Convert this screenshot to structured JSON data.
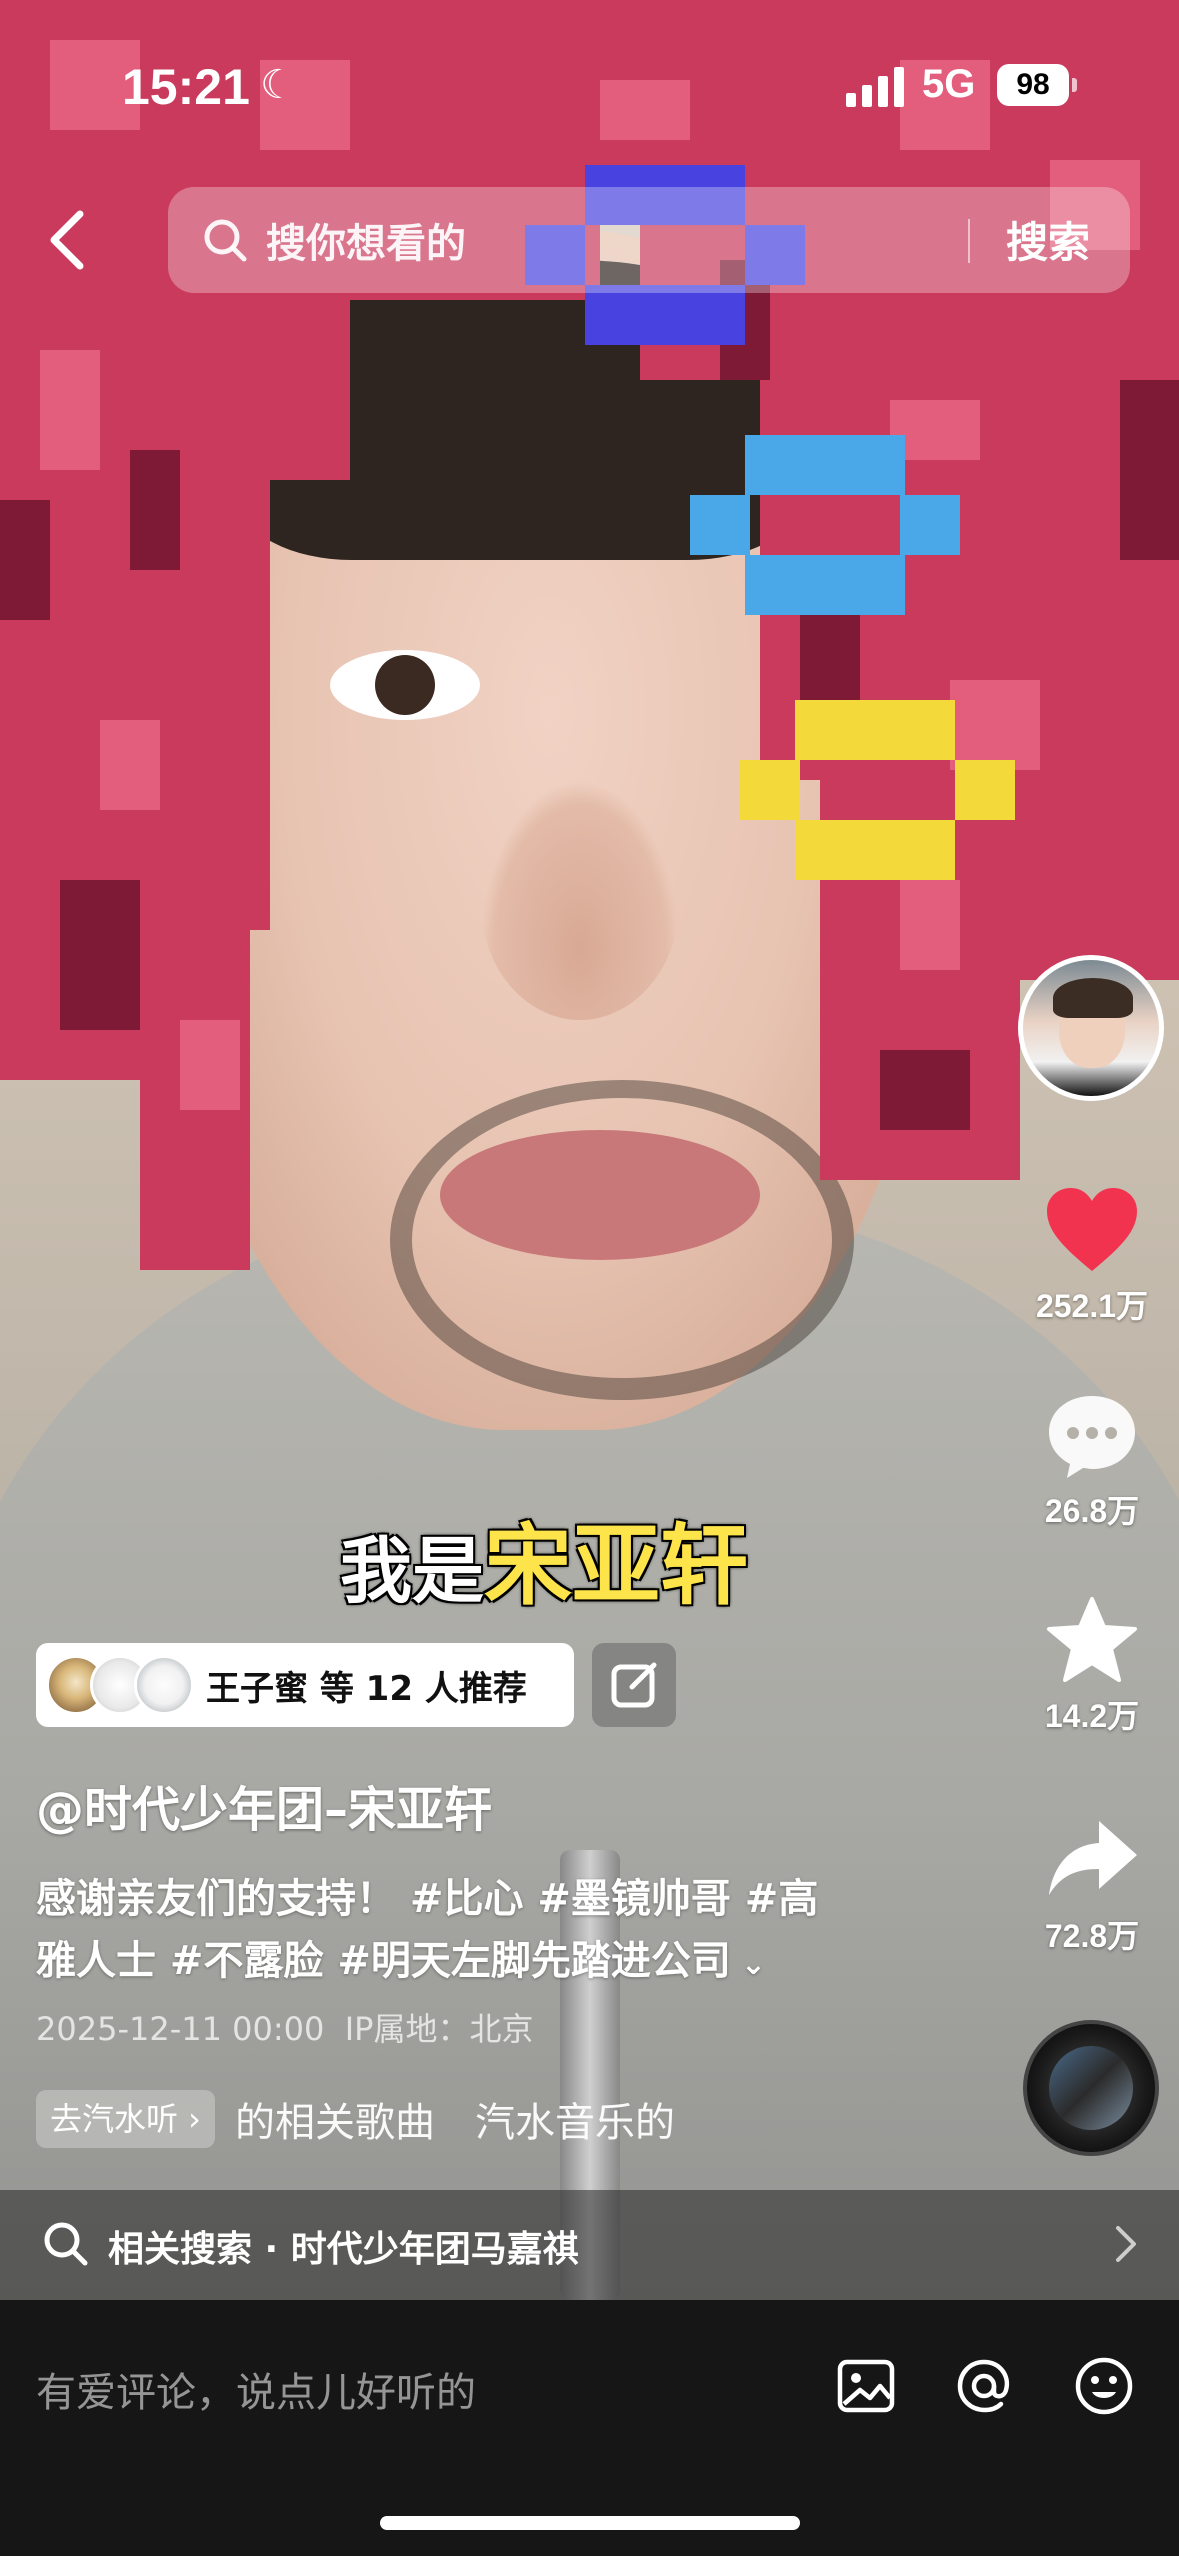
{
  "status_bar": {
    "time": "15:21",
    "network": "5G",
    "battery": "98"
  },
  "top_search": {
    "placeholder": "搜你想看的",
    "button_label": "搜索"
  },
  "video": {
    "caption_prefix": "我是",
    "caption_highlight": "宋亚轩"
  },
  "actions": {
    "likes": "252.1万",
    "comments": "26.8万",
    "favorites": "14.2万",
    "shares": "72.8万"
  },
  "recommend": {
    "text": "王子蜜 等 12 人推荐"
  },
  "author": "@时代少年团–宋亚轩",
  "description": {
    "line1": "感谢亲友们的支持！ #比心 #墨镜帅哥 #高",
    "line2": "雅人士 #不露脸 #明天左脚先踏进公司"
  },
  "meta": {
    "datetime": "2025-12-11 00:00",
    "location": "IP属地：北京"
  },
  "music": {
    "tag": "去汽水听 ›",
    "text": "的相关歌曲　汽水音乐的"
  },
  "related_search": {
    "text": "相关搜索 · 时代少年团马嘉祺"
  },
  "comment_bar": {
    "placeholder": "有爱评论，说点儿好听的"
  },
  "colors": {
    "like_red": "#f2334f",
    "caption_yellow": "#fde44a",
    "comment_bar_bg": "#161616"
  }
}
